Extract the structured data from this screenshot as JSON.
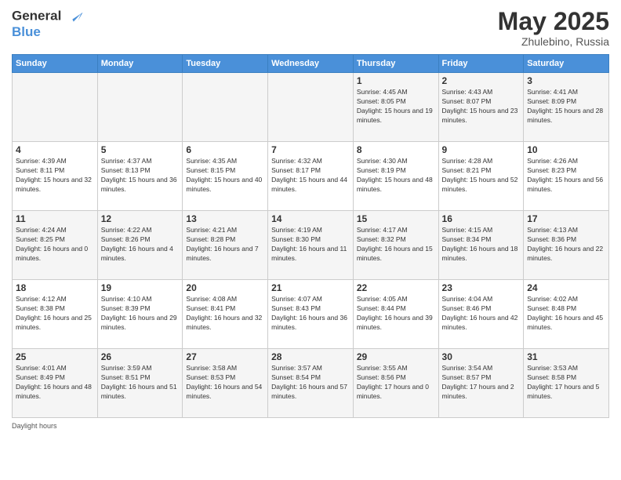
{
  "logo": {
    "line1": "General",
    "line2": "Blue"
  },
  "title": "May 2025",
  "location": "Zhulebino, Russia",
  "days_of_week": [
    "Sunday",
    "Monday",
    "Tuesday",
    "Wednesday",
    "Thursday",
    "Friday",
    "Saturday"
  ],
  "footer_label": "Daylight hours",
  "weeks": [
    [
      {
        "day": "",
        "sunrise": "",
        "sunset": "",
        "daylight": ""
      },
      {
        "day": "",
        "sunrise": "",
        "sunset": "",
        "daylight": ""
      },
      {
        "day": "",
        "sunrise": "",
        "sunset": "",
        "daylight": ""
      },
      {
        "day": "",
        "sunrise": "",
        "sunset": "",
        "daylight": ""
      },
      {
        "day": "1",
        "sunrise": "Sunrise: 4:45 AM",
        "sunset": "Sunset: 8:05 PM",
        "daylight": "Daylight: 15 hours and 19 minutes."
      },
      {
        "day": "2",
        "sunrise": "Sunrise: 4:43 AM",
        "sunset": "Sunset: 8:07 PM",
        "daylight": "Daylight: 15 hours and 23 minutes."
      },
      {
        "day": "3",
        "sunrise": "Sunrise: 4:41 AM",
        "sunset": "Sunset: 8:09 PM",
        "daylight": "Daylight: 15 hours and 28 minutes."
      }
    ],
    [
      {
        "day": "4",
        "sunrise": "Sunrise: 4:39 AM",
        "sunset": "Sunset: 8:11 PM",
        "daylight": "Daylight: 15 hours and 32 minutes."
      },
      {
        "day": "5",
        "sunrise": "Sunrise: 4:37 AM",
        "sunset": "Sunset: 8:13 PM",
        "daylight": "Daylight: 15 hours and 36 minutes."
      },
      {
        "day": "6",
        "sunrise": "Sunrise: 4:35 AM",
        "sunset": "Sunset: 8:15 PM",
        "daylight": "Daylight: 15 hours and 40 minutes."
      },
      {
        "day": "7",
        "sunrise": "Sunrise: 4:32 AM",
        "sunset": "Sunset: 8:17 PM",
        "daylight": "Daylight: 15 hours and 44 minutes."
      },
      {
        "day": "8",
        "sunrise": "Sunrise: 4:30 AM",
        "sunset": "Sunset: 8:19 PM",
        "daylight": "Daylight: 15 hours and 48 minutes."
      },
      {
        "day": "9",
        "sunrise": "Sunrise: 4:28 AM",
        "sunset": "Sunset: 8:21 PM",
        "daylight": "Daylight: 15 hours and 52 minutes."
      },
      {
        "day": "10",
        "sunrise": "Sunrise: 4:26 AM",
        "sunset": "Sunset: 8:23 PM",
        "daylight": "Daylight: 15 hours and 56 minutes."
      }
    ],
    [
      {
        "day": "11",
        "sunrise": "Sunrise: 4:24 AM",
        "sunset": "Sunset: 8:25 PM",
        "daylight": "Daylight: 16 hours and 0 minutes."
      },
      {
        "day": "12",
        "sunrise": "Sunrise: 4:22 AM",
        "sunset": "Sunset: 8:26 PM",
        "daylight": "Daylight: 16 hours and 4 minutes."
      },
      {
        "day": "13",
        "sunrise": "Sunrise: 4:21 AM",
        "sunset": "Sunset: 8:28 PM",
        "daylight": "Daylight: 16 hours and 7 minutes."
      },
      {
        "day": "14",
        "sunrise": "Sunrise: 4:19 AM",
        "sunset": "Sunset: 8:30 PM",
        "daylight": "Daylight: 16 hours and 11 minutes."
      },
      {
        "day": "15",
        "sunrise": "Sunrise: 4:17 AM",
        "sunset": "Sunset: 8:32 PM",
        "daylight": "Daylight: 16 hours and 15 minutes."
      },
      {
        "day": "16",
        "sunrise": "Sunrise: 4:15 AM",
        "sunset": "Sunset: 8:34 PM",
        "daylight": "Daylight: 16 hours and 18 minutes."
      },
      {
        "day": "17",
        "sunrise": "Sunrise: 4:13 AM",
        "sunset": "Sunset: 8:36 PM",
        "daylight": "Daylight: 16 hours and 22 minutes."
      }
    ],
    [
      {
        "day": "18",
        "sunrise": "Sunrise: 4:12 AM",
        "sunset": "Sunset: 8:38 PM",
        "daylight": "Daylight: 16 hours and 25 minutes."
      },
      {
        "day": "19",
        "sunrise": "Sunrise: 4:10 AM",
        "sunset": "Sunset: 8:39 PM",
        "daylight": "Daylight: 16 hours and 29 minutes."
      },
      {
        "day": "20",
        "sunrise": "Sunrise: 4:08 AM",
        "sunset": "Sunset: 8:41 PM",
        "daylight": "Daylight: 16 hours and 32 minutes."
      },
      {
        "day": "21",
        "sunrise": "Sunrise: 4:07 AM",
        "sunset": "Sunset: 8:43 PM",
        "daylight": "Daylight: 16 hours and 36 minutes."
      },
      {
        "day": "22",
        "sunrise": "Sunrise: 4:05 AM",
        "sunset": "Sunset: 8:44 PM",
        "daylight": "Daylight: 16 hours and 39 minutes."
      },
      {
        "day": "23",
        "sunrise": "Sunrise: 4:04 AM",
        "sunset": "Sunset: 8:46 PM",
        "daylight": "Daylight: 16 hours and 42 minutes."
      },
      {
        "day": "24",
        "sunrise": "Sunrise: 4:02 AM",
        "sunset": "Sunset: 8:48 PM",
        "daylight": "Daylight: 16 hours and 45 minutes."
      }
    ],
    [
      {
        "day": "25",
        "sunrise": "Sunrise: 4:01 AM",
        "sunset": "Sunset: 8:49 PM",
        "daylight": "Daylight: 16 hours and 48 minutes."
      },
      {
        "day": "26",
        "sunrise": "Sunrise: 3:59 AM",
        "sunset": "Sunset: 8:51 PM",
        "daylight": "Daylight: 16 hours and 51 minutes."
      },
      {
        "day": "27",
        "sunrise": "Sunrise: 3:58 AM",
        "sunset": "Sunset: 8:53 PM",
        "daylight": "Daylight: 16 hours and 54 minutes."
      },
      {
        "day": "28",
        "sunrise": "Sunrise: 3:57 AM",
        "sunset": "Sunset: 8:54 PM",
        "daylight": "Daylight: 16 hours and 57 minutes."
      },
      {
        "day": "29",
        "sunrise": "Sunrise: 3:55 AM",
        "sunset": "Sunset: 8:56 PM",
        "daylight": "Daylight: 17 hours and 0 minutes."
      },
      {
        "day": "30",
        "sunrise": "Sunrise: 3:54 AM",
        "sunset": "Sunset: 8:57 PM",
        "daylight": "Daylight: 17 hours and 2 minutes."
      },
      {
        "day": "31",
        "sunrise": "Sunrise: 3:53 AM",
        "sunset": "Sunset: 8:58 PM",
        "daylight": "Daylight: 17 hours and 5 minutes."
      }
    ]
  ]
}
